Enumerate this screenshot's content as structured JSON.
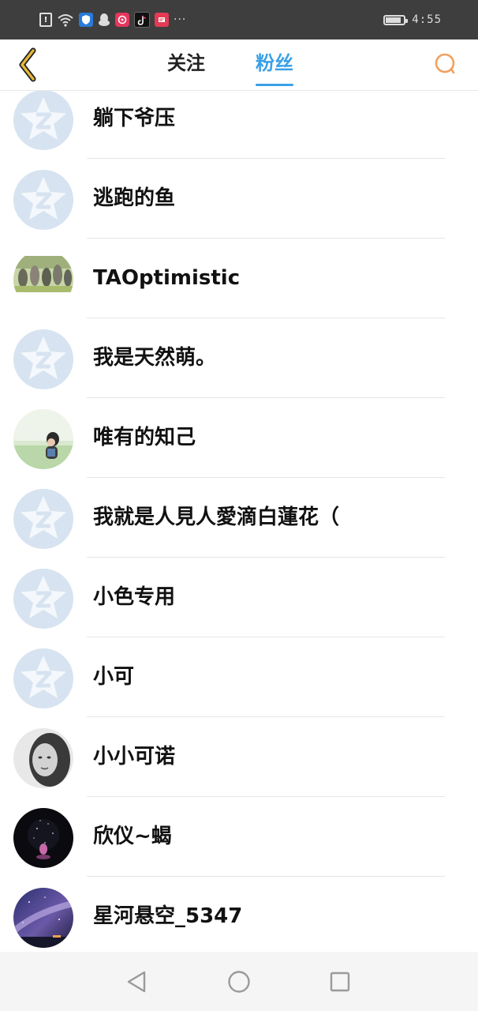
{
  "status_bar": {
    "time": "4:55",
    "battery_level": 0.85,
    "icons": [
      "alert-icon",
      "wifi-icon",
      "shield-app-icon",
      "qq-penguin-icon",
      "netease-music-icon",
      "tiktok-icon",
      "news-app-icon"
    ],
    "more": "···"
  },
  "header": {
    "tabs": [
      {
        "label": "关注",
        "active": false
      },
      {
        "label": "粉丝",
        "active": true
      }
    ],
    "accent_color": "#3aa0e6",
    "back_icon": "chevron-left-icon",
    "back_icon_color": "#e6b83a",
    "search_icon": "search-icon",
    "search_icon_color": "#f0a060"
  },
  "fans": [
    {
      "name": "躺下爷压",
      "avatar": "default"
    },
    {
      "name": "逃跑的鱼",
      "avatar": "default"
    },
    {
      "name": "TAOptimistic",
      "avatar": "group-photo"
    },
    {
      "name": "我是天然萌。",
      "avatar": "default"
    },
    {
      "name": "唯有的知己",
      "avatar": "girl-field"
    },
    {
      "name": "我就是人見人愛滴白蓮花（",
      "avatar": "default"
    },
    {
      "name": "小色专用",
      "avatar": "default"
    },
    {
      "name": "小可",
      "avatar": "default"
    },
    {
      "name": "小小可诺",
      "avatar": "bw-portrait"
    },
    {
      "name": "欣仪~蝎",
      "avatar": "dark-night"
    },
    {
      "name": "星河悬空_5347",
      "avatar": "galaxy"
    }
  ],
  "nav_bar": {
    "buttons": [
      "back-triangle-icon",
      "home-circle-icon",
      "recents-square-icon"
    ]
  }
}
